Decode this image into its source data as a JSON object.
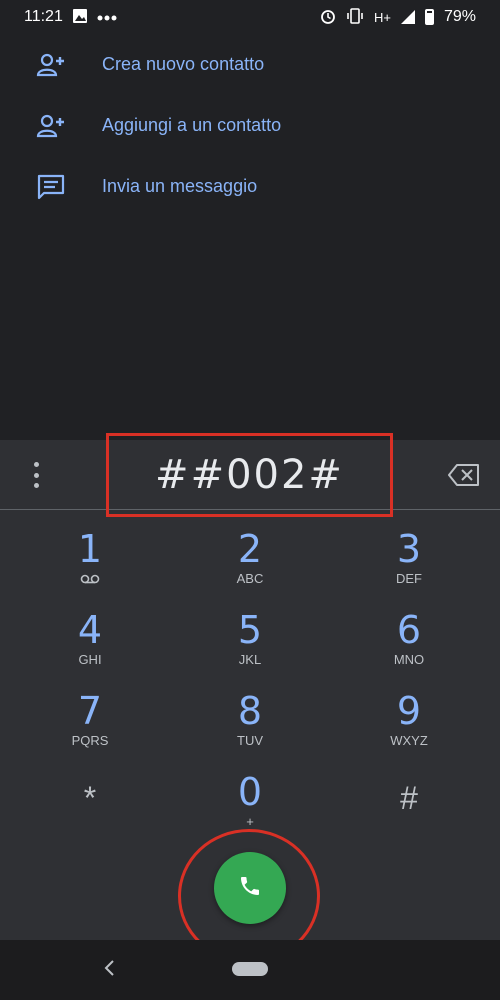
{
  "status_bar": {
    "time": "11:21",
    "network": "H+",
    "battery": "79%",
    "icons": [
      "image-icon",
      "more-dots-icon",
      "alarm-icon",
      "vibrate-icon",
      "signal-icon",
      "battery-icon"
    ]
  },
  "actions": [
    {
      "label": "Crea nuovo contatto",
      "icon": "add-person-icon"
    },
    {
      "label": "Aggiungi a un contatto",
      "icon": "add-person-icon"
    },
    {
      "label": "Invia un messaggio",
      "icon": "message-icon"
    }
  ],
  "dialer": {
    "digits": "##002#",
    "keys": [
      {
        "digit": "1",
        "letters": ""
      },
      {
        "digit": "2",
        "letters": "ABC"
      },
      {
        "digit": "3",
        "letters": "DEF"
      },
      {
        "digit": "4",
        "letters": "GHI"
      },
      {
        "digit": "5",
        "letters": "JKL"
      },
      {
        "digit": "6",
        "letters": "MNO"
      },
      {
        "digit": "7",
        "letters": "PQRS"
      },
      {
        "digit": "8",
        "letters": "TUV"
      },
      {
        "digit": "9",
        "letters": "WXYZ"
      },
      {
        "digit": "*",
        "letters": ""
      },
      {
        "digit": "0",
        "letters": "+"
      },
      {
        "digit": "#",
        "letters": ""
      }
    ]
  },
  "colors": {
    "accent": "#8ab4f8",
    "call_button": "#34a853",
    "highlight": "#d93025",
    "background": "#202124",
    "dialpad": "#2f3034"
  }
}
